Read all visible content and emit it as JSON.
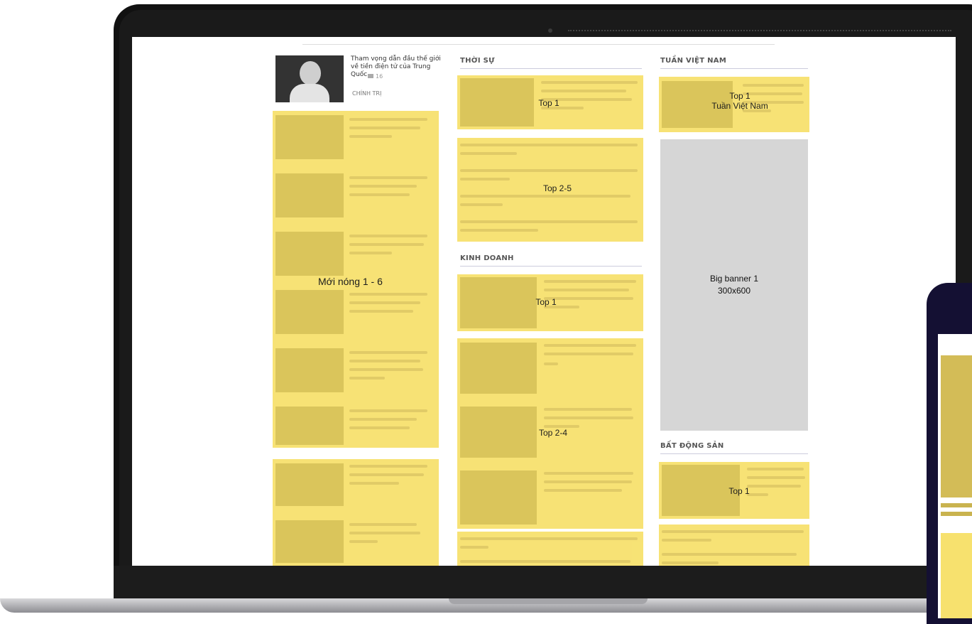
{
  "feature": {
    "title": "Tham vọng dẫn đầu thế giới về tiền điện tử của Trung Quốc",
    "count": "16",
    "category": "CHÍNH TRỊ"
  },
  "sections": {
    "thoi_su": "THỜI SỰ",
    "kinh_doanh": "KINH DOANH",
    "tuan_viet_nam": "TUẦN VIỆT NAM",
    "bat_dong_san": "BẤT ĐỘNG SẢN"
  },
  "labels": {
    "moi_nong": "Mới nóng 1 - 6",
    "thoi_su_top1": "Top 1",
    "thoi_su_top25": "Top 2-5",
    "kinh_doanh_top1": "Top 1",
    "kinh_doanh_top24": "Top 2-4",
    "tvn_top1_line1": "Top 1",
    "tvn_top1_line2": "Tuần Việt Nam",
    "banner_line1": "Big banner 1",
    "banner_line2": "300x600",
    "bds_top1": "Top 1"
  }
}
